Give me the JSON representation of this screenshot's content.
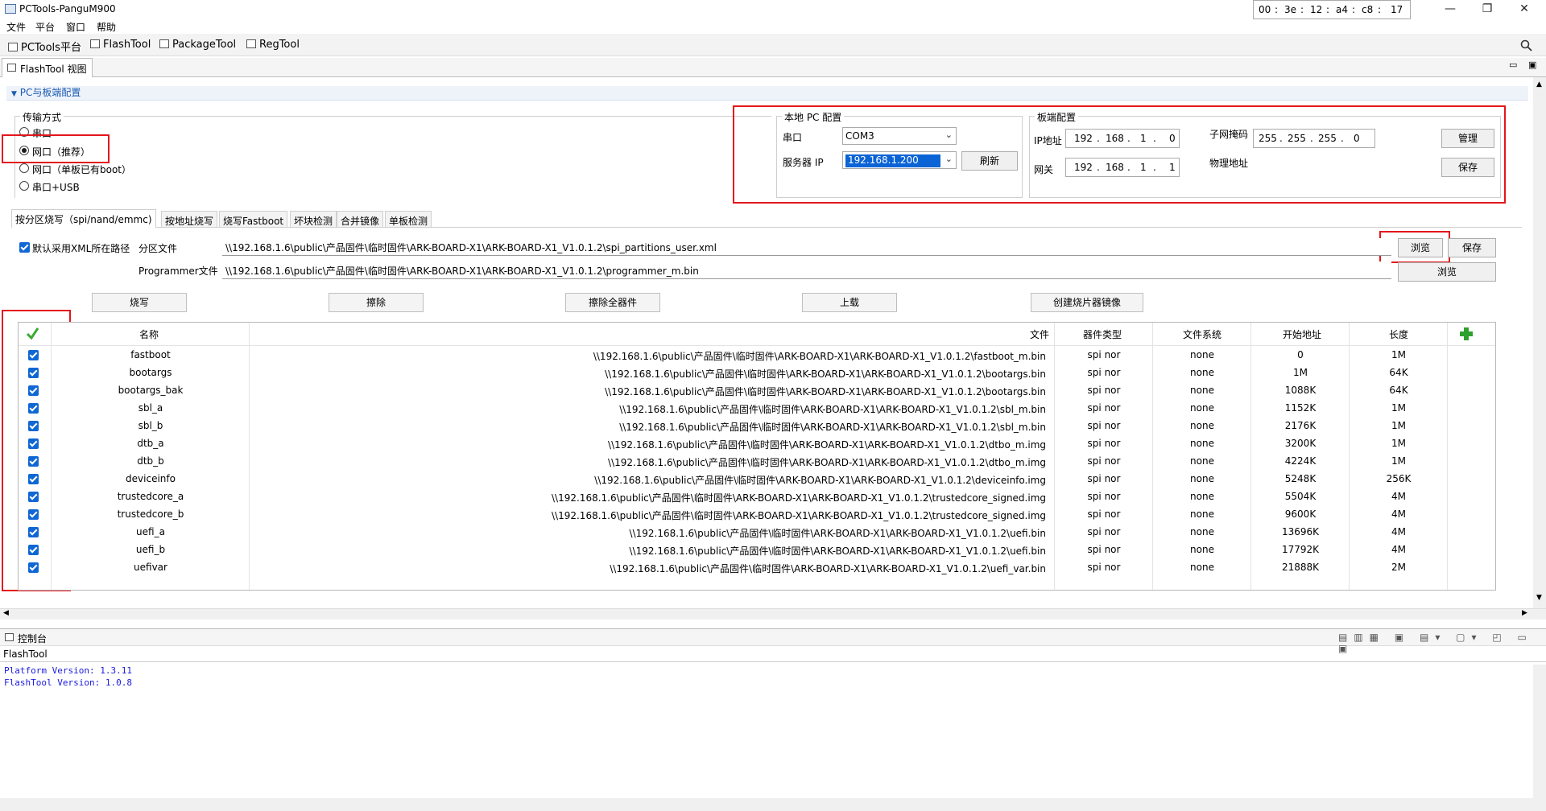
{
  "window": {
    "title": "PCTools-PanguM900",
    "minimize": "—",
    "maximize": "❐",
    "close": "✕"
  },
  "menu": [
    "文件",
    "平台",
    "窗口",
    "帮助"
  ],
  "toolbar": {
    "items": [
      "PCTools平台",
      "FlashTool",
      "PackageTool",
      "RegTool"
    ],
    "search_icon": "search-icon"
  },
  "view_tab": {
    "label": "FlashTool 视图"
  },
  "section": {
    "title": "PC与板端配置"
  },
  "transport": {
    "title": "传输方式",
    "options": [
      "串口",
      "网口（推荐）",
      "网口（单板已有boot）",
      "串口+USB"
    ],
    "selected_index": 1
  },
  "local_pc": {
    "title": "本地 PC 配置",
    "serial_label": "串口",
    "serial_value": "COM3",
    "server_ip_label": "服务器 IP",
    "server_ip_value": "192.168.1.200",
    "refresh": "刷新"
  },
  "board": {
    "title": "板端配置",
    "ip_label": "IP地址",
    "ip": [
      "192",
      "168",
      "1",
      "0"
    ],
    "gateway_label": "网关",
    "gateway": [
      "192",
      "168",
      "1",
      "1"
    ],
    "mask_label": "子网掩码",
    "mask": [
      "255",
      "255",
      "255",
      "0"
    ],
    "mac_label": "物理地址",
    "mac": [
      "00",
      "3e",
      "12",
      "a4",
      "c8",
      "17"
    ],
    "manage": "管理",
    "save": "保存"
  },
  "flash_tabs": [
    "按分区烧写（spi/nand/emmc)",
    "按地址烧写",
    "烧写Fastboot",
    "坏块检测",
    "合并镜像",
    "单板检测"
  ],
  "paths": {
    "use_xml_label": "默认采用XML所在路径",
    "partition_label": "分区文件",
    "partition_value": "\\\\192.168.1.6\\public\\产品固件\\临时固件\\ARK-BOARD-X1\\ARK-BOARD-X1_V1.0.1.2\\spi_partitions_user.xml",
    "programmer_label": "Programmer文件",
    "programmer_value": "\\\\192.168.1.6\\public\\产品固件\\临时固件\\ARK-BOARD-X1\\ARK-BOARD-X1_V1.0.1.2\\programmer_m.bin",
    "browse": "浏览",
    "save": "保存"
  },
  "actions": [
    "烧写",
    "擦除",
    "擦除全器件",
    "上载",
    "创建烧片器镜像"
  ],
  "table": {
    "headers": [
      "名称",
      "文件",
      "器件类型",
      "文件系统",
      "开始地址",
      "长度"
    ],
    "rows": [
      {
        "name": "fastboot",
        "file": "\\\\192.168.1.6\\public\\产品固件\\临时固件\\ARK-BOARD-X1\\ARK-BOARD-X1_V1.0.1.2\\fastboot_m.bin",
        "type": "spi nor",
        "fs": "none",
        "start": "0",
        "len": "1M"
      },
      {
        "name": "bootargs",
        "file": "\\\\192.168.1.6\\public\\产品固件\\临时固件\\ARK-BOARD-X1\\ARK-BOARD-X1_V1.0.1.2\\bootargs.bin",
        "type": "spi nor",
        "fs": "none",
        "start": "1M",
        "len": "64K"
      },
      {
        "name": "bootargs_bak",
        "file": "\\\\192.168.1.6\\public\\产品固件\\临时固件\\ARK-BOARD-X1\\ARK-BOARD-X1_V1.0.1.2\\bootargs.bin",
        "type": "spi nor",
        "fs": "none",
        "start": "1088K",
        "len": "64K"
      },
      {
        "name": "sbl_a",
        "file": "\\\\192.168.1.6\\public\\产品固件\\临时固件\\ARK-BOARD-X1\\ARK-BOARD-X1_V1.0.1.2\\sbl_m.bin",
        "type": "spi nor",
        "fs": "none",
        "start": "1152K",
        "len": "1M"
      },
      {
        "name": "sbl_b",
        "file": "\\\\192.168.1.6\\public\\产品固件\\临时固件\\ARK-BOARD-X1\\ARK-BOARD-X1_V1.0.1.2\\sbl_m.bin",
        "type": "spi nor",
        "fs": "none",
        "start": "2176K",
        "len": "1M"
      },
      {
        "name": "dtb_a",
        "file": "\\\\192.168.1.6\\public\\产品固件\\临时固件\\ARK-BOARD-X1\\ARK-BOARD-X1_V1.0.1.2\\dtbo_m.img",
        "type": "spi nor",
        "fs": "none",
        "start": "3200K",
        "len": "1M"
      },
      {
        "name": "dtb_b",
        "file": "\\\\192.168.1.6\\public\\产品固件\\临时固件\\ARK-BOARD-X1\\ARK-BOARD-X1_V1.0.1.2\\dtbo_m.img",
        "type": "spi nor",
        "fs": "none",
        "start": "4224K",
        "len": "1M"
      },
      {
        "name": "deviceinfo",
        "file": "\\\\192.168.1.6\\public\\产品固件\\临时固件\\ARK-BOARD-X1\\ARK-BOARD-X1_V1.0.1.2\\deviceinfo.img",
        "type": "spi nor",
        "fs": "none",
        "start": "5248K",
        "len": "256K"
      },
      {
        "name": "trustedcore_a",
        "file": "\\\\192.168.1.6\\public\\产品固件\\临时固件\\ARK-BOARD-X1\\ARK-BOARD-X1_V1.0.1.2\\trustedcore_signed.img",
        "type": "spi nor",
        "fs": "none",
        "start": "5504K",
        "len": "4M"
      },
      {
        "name": "trustedcore_b",
        "file": "\\\\192.168.1.6\\public\\产品固件\\临时固件\\ARK-BOARD-X1\\ARK-BOARD-X1_V1.0.1.2\\trustedcore_signed.img",
        "type": "spi nor",
        "fs": "none",
        "start": "9600K",
        "len": "4M"
      },
      {
        "name": "uefi_a",
        "file": "\\\\192.168.1.6\\public\\产品固件\\临时固件\\ARK-BOARD-X1\\ARK-BOARD-X1_V1.0.1.2\\uefi.bin",
        "type": "spi nor",
        "fs": "none",
        "start": "13696K",
        "len": "4M"
      },
      {
        "name": "uefi_b",
        "file": "\\\\192.168.1.6\\public\\产品固件\\临时固件\\ARK-BOARD-X1\\ARK-BOARD-X1_V1.0.1.2\\uefi.bin",
        "type": "spi nor",
        "fs": "none",
        "start": "17792K",
        "len": "4M"
      },
      {
        "name": "uefivar",
        "file": "\\\\192.168.1.6\\public\\产品固件\\临时固件\\ARK-BOARD-X1\\ARK-BOARD-X1_V1.0.1.2\\uefi_var.bin",
        "type": "spi nor",
        "fs": "none",
        "start": "21888K",
        "len": "2M"
      }
    ]
  },
  "console": {
    "tab": "控制台",
    "label": "FlashTool",
    "lines": [
      "Platform Version: 1.3.11",
      "FlashTool Version: 1.0.8"
    ]
  },
  "colors": {
    "accent": "#1c5bb0",
    "highlight_box": "#e3161c",
    "check": "#1067d4",
    "console_text": "#1a1adf"
  }
}
